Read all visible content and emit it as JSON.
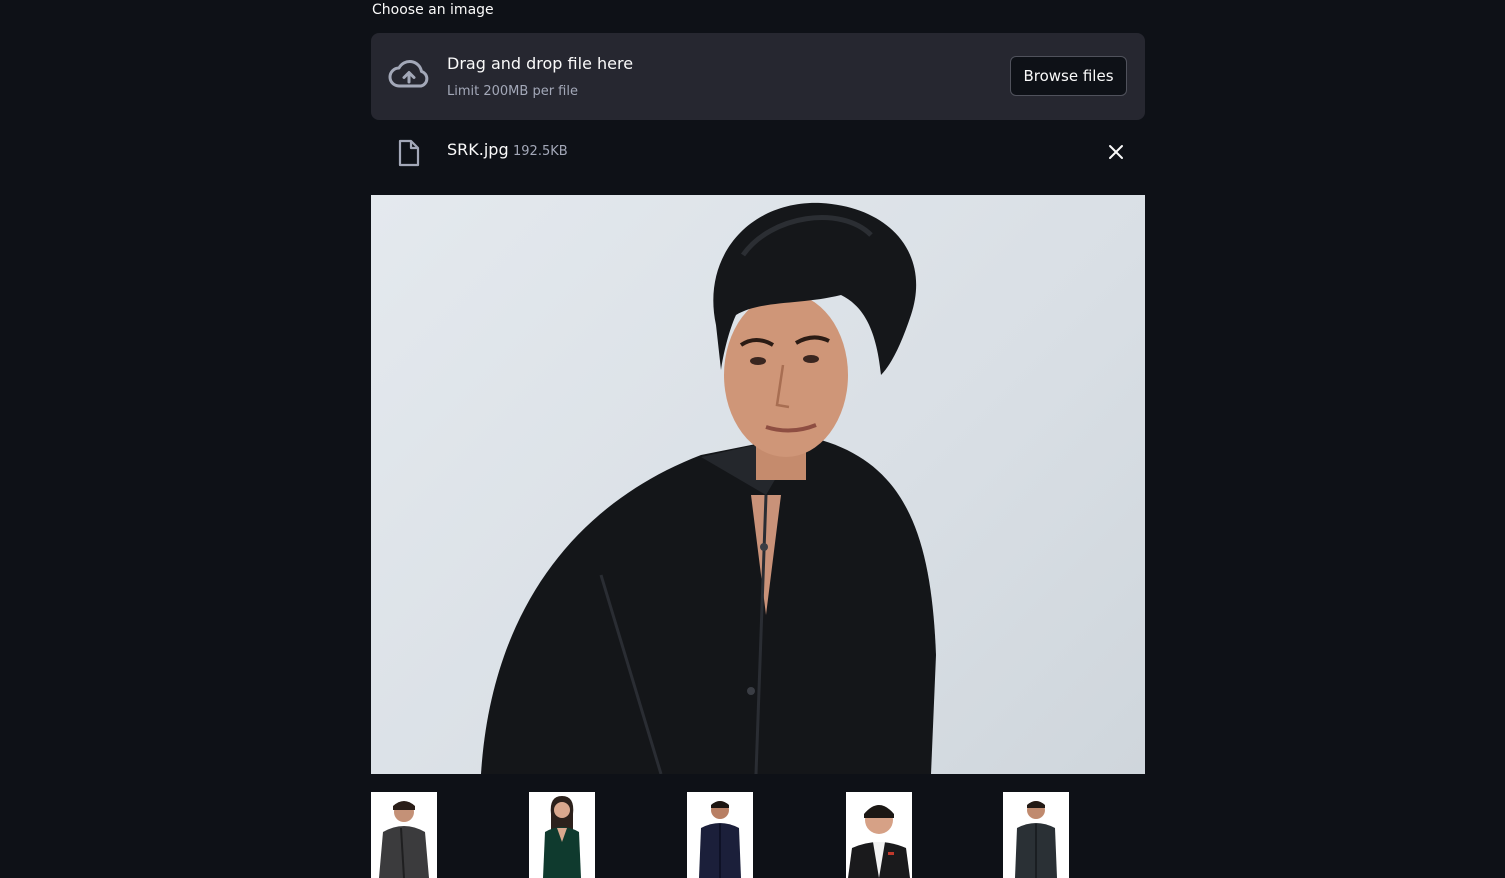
{
  "uploader": {
    "label": "Choose an image",
    "dropzone_title": "Drag and drop file here",
    "dropzone_limit": "Limit 200MB per file",
    "browse_label": "Browse files"
  },
  "file": {
    "name": "SRK.jpg",
    "size": "192.5KB"
  },
  "icons": {
    "upload": "cloud-upload-icon",
    "file": "file-icon",
    "close": "close-icon"
  },
  "colors": {
    "background": "#0e1117",
    "dropzone": "#262730",
    "text": "#fafafa",
    "muted_text": "#a3a8b8"
  }
}
